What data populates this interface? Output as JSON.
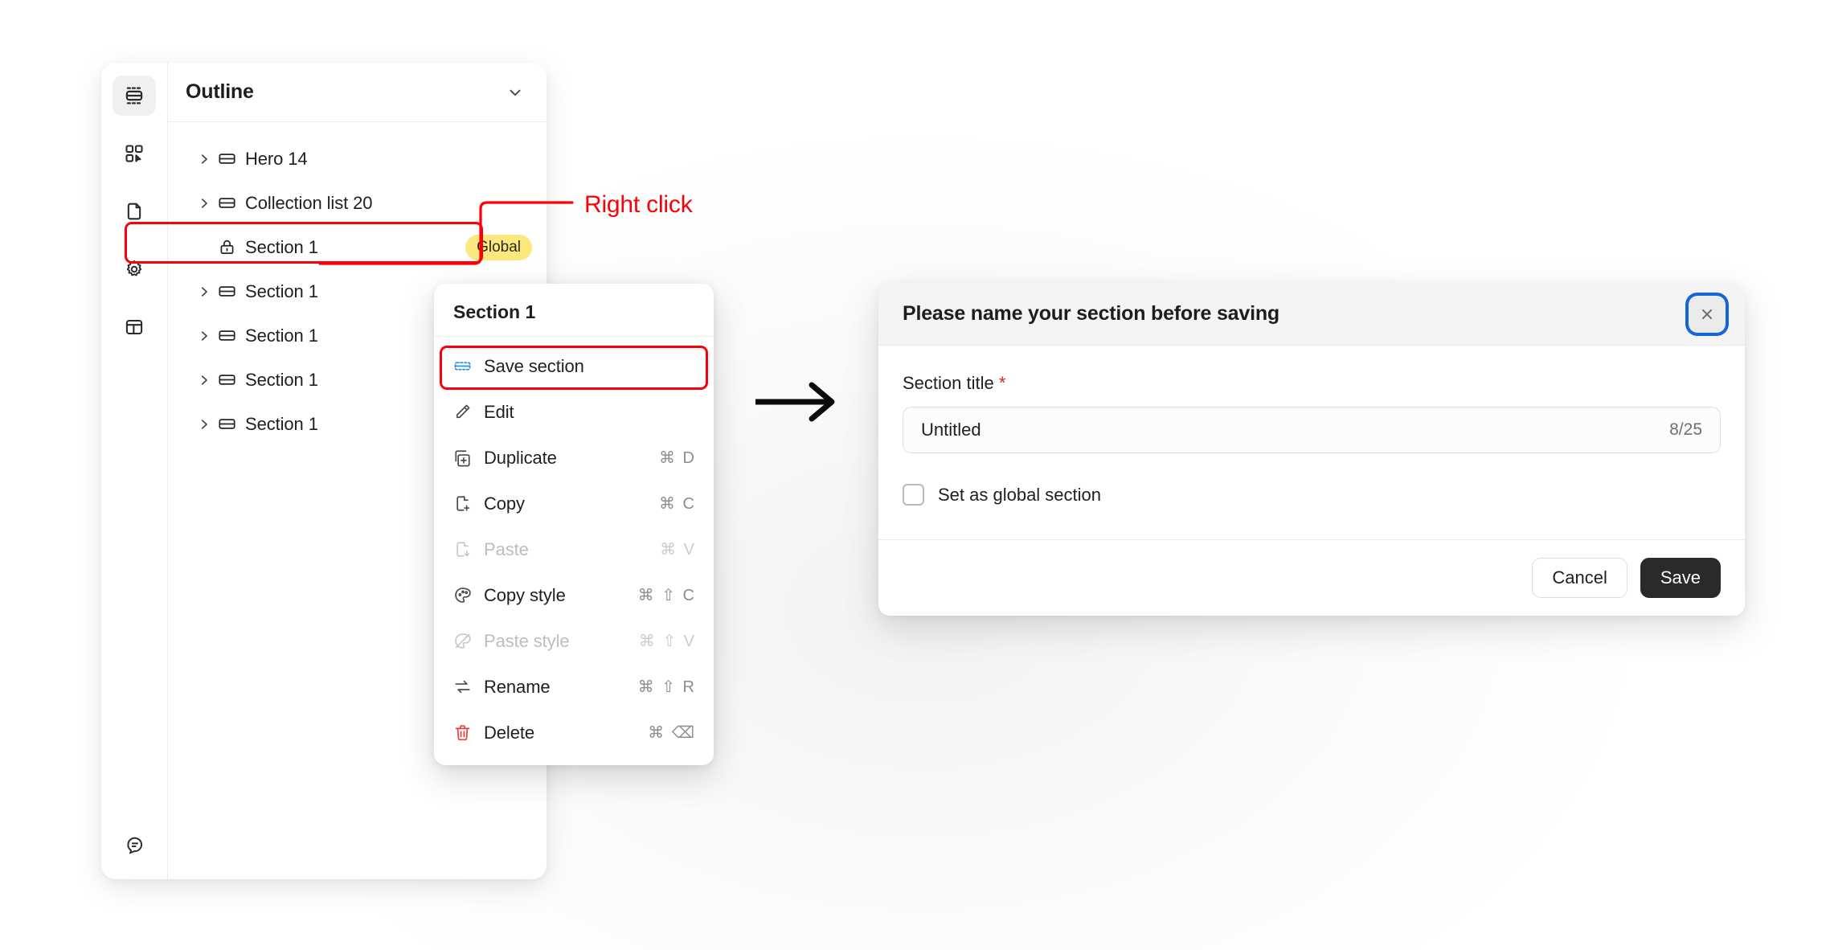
{
  "annotation": {
    "right_click_label": "Right click",
    "arrow_icon": "arrow-right-icon",
    "highlight_color": "#fb0007"
  },
  "sidebar": {
    "items": [
      {
        "icon": "sections-outline-icon",
        "name": "sidebar-item-sections",
        "active": true
      },
      {
        "icon": "components-grid-icon",
        "name": "sidebar-item-components",
        "active": false
      },
      {
        "icon": "page-file-icon",
        "name": "sidebar-item-pages",
        "active": false
      },
      {
        "icon": "settings-gear-icon",
        "name": "sidebar-item-settings",
        "active": false
      },
      {
        "icon": "layout-template-icon",
        "name": "sidebar-item-layouts",
        "active": false
      }
    ],
    "bottom": {
      "icon": "chat-bubble-icon",
      "name": "sidebar-item-support"
    }
  },
  "outline": {
    "title": "Outline",
    "chevron_icon": "chevron-down-icon",
    "rows": [
      {
        "label": "Hero 14",
        "caret": true,
        "icon": "section-block-icon",
        "badge": ""
      },
      {
        "label": "Collection list 20",
        "caret": true,
        "icon": "section-block-icon",
        "badge": ""
      },
      {
        "label": "Section 1",
        "caret": false,
        "icon": "lock-icon",
        "badge": "Global"
      },
      {
        "label": "Section 1",
        "caret": true,
        "icon": "section-block-icon",
        "badge": "",
        "highlighted": true
      },
      {
        "label": "Section 1",
        "caret": true,
        "icon": "section-block-icon",
        "badge": ""
      },
      {
        "label": "Section 1",
        "caret": true,
        "icon": "section-block-icon",
        "badge": ""
      },
      {
        "label": "Section 1",
        "caret": true,
        "icon": "section-block-icon",
        "badge": ""
      }
    ]
  },
  "context_menu": {
    "header": "Section 1",
    "items": [
      {
        "label": "Save section",
        "shortcut": "",
        "icon": "save-section-icon",
        "disabled": false,
        "highlighted": true,
        "accent": "#2d8fe0"
      },
      {
        "label": "Edit",
        "shortcut": "",
        "icon": "pencil-icon",
        "disabled": false
      },
      {
        "label": "Duplicate",
        "shortcut": "⌘ D",
        "icon": "duplicate-icon",
        "disabled": false
      },
      {
        "label": "Copy",
        "shortcut": "⌘ C",
        "icon": "copy-file-icon",
        "disabled": false
      },
      {
        "label": "Paste",
        "shortcut": "⌘ V",
        "icon": "paste-file-icon",
        "disabled": true
      },
      {
        "label": "Copy style",
        "shortcut": "⌘ ⇧ C",
        "icon": "palette-icon",
        "disabled": false
      },
      {
        "label": "Paste style",
        "shortcut": "⌘ ⇧ V",
        "icon": "palette-paste-icon",
        "disabled": true
      },
      {
        "label": "Rename",
        "shortcut": "⌘ ⇧ R",
        "icon": "rename-arrows-icon",
        "disabled": false
      },
      {
        "label": "Delete",
        "shortcut": "⌘ ⌫",
        "icon": "trash-icon",
        "disabled": false,
        "danger": true
      }
    ]
  },
  "modal": {
    "title": "Please name your section before saving",
    "close_icon": "close-x-icon",
    "field_label": "Section title",
    "required_mark": "*",
    "input_value": "Untitled",
    "input_counter": "8/25",
    "checkbox_label": "Set as global section",
    "checkbox_checked": false,
    "cancel_label": "Cancel",
    "save_label": "Save"
  }
}
